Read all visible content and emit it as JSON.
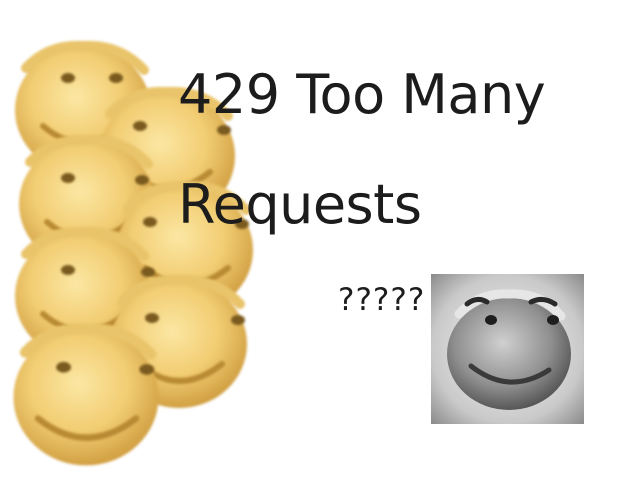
{
  "meme": {
    "title": "429 Too Many Requests",
    "question": "?????"
  },
  "colors": {
    "smiley_face": "#f2cd73",
    "smiley_rim": "#caa046",
    "smiley_feature": "#7a5a1e",
    "gray_face": "#8a8a8a",
    "text": "#1c1c1c"
  },
  "icons": {
    "yellow_smiley": "blurry-yellow-smiley-icon",
    "gray_smiley": "grayscale-smiley-icon"
  }
}
